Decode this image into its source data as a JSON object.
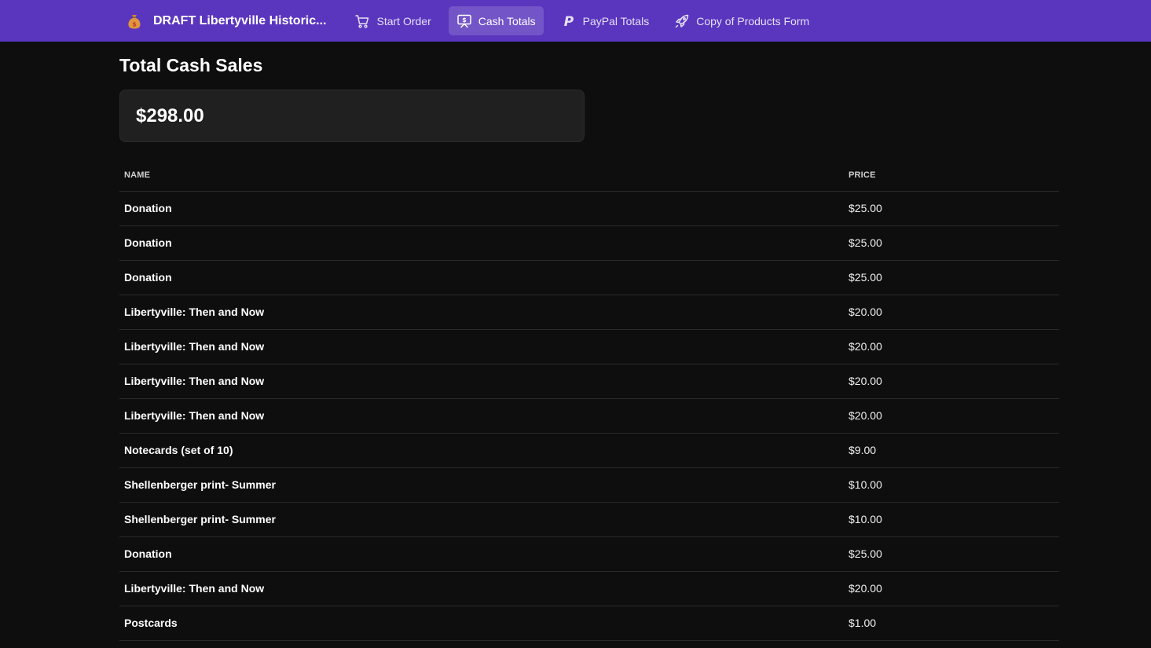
{
  "header": {
    "title": "DRAFT Libertyville Historic...",
    "nav": [
      {
        "label": "Start Order",
        "icon": "cart-icon",
        "active": false
      },
      {
        "label": "Cash Totals",
        "icon": "cash-register-icon",
        "active": true
      },
      {
        "label": "PayPal Totals",
        "icon": "paypal-icon",
        "active": false
      },
      {
        "label": "Copy of Products Form",
        "icon": "rocket-icon",
        "active": false
      }
    ]
  },
  "main": {
    "title": "Total Cash Sales",
    "total": "$298.00",
    "table": {
      "columns": [
        "NAME",
        "PRICE"
      ],
      "rows": [
        {
          "name": "Donation",
          "price": "$25.00"
        },
        {
          "name": "Donation",
          "price": "$25.00"
        },
        {
          "name": "Donation",
          "price": "$25.00"
        },
        {
          "name": "Libertyville: Then and Now",
          "price": "$20.00"
        },
        {
          "name": "Libertyville: Then and Now",
          "price": "$20.00"
        },
        {
          "name": "Libertyville: Then and Now",
          "price": "$20.00"
        },
        {
          "name": "Libertyville: Then and Now",
          "price": "$20.00"
        },
        {
          "name": "Notecards (set of 10)",
          "price": "$9.00"
        },
        {
          "name": "Shellenberger print- Summer",
          "price": "$10.00"
        },
        {
          "name": "Shellenberger print- Summer",
          "price": "$10.00"
        },
        {
          "name": "Donation",
          "price": "$25.00"
        },
        {
          "name": "Libertyville: Then and Now",
          "price": "$20.00"
        },
        {
          "name": "Postcards",
          "price": "$1.00"
        }
      ]
    }
  },
  "colors": {
    "topbar": "#5a35be",
    "background": "#0e0e0e",
    "card": "#202020"
  }
}
